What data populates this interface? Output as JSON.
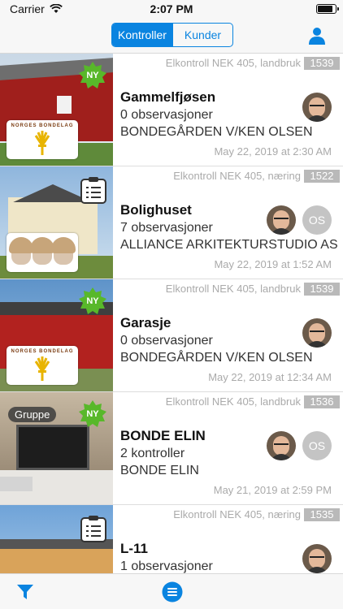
{
  "status": {
    "carrier": "Carrier",
    "time": "2:07 PM",
    "battery_level": 0.9
  },
  "nav": {
    "segments": [
      "Kontroller",
      "Kunder"
    ],
    "active_segment": "Kontroller",
    "profile_icon": "person-icon"
  },
  "accent": "#0a84e0",
  "rows": [
    {
      "type": "Elkontroll NEK 405, landbruk",
      "number": "1539",
      "title": "Gammelfjøsen",
      "line1": "0 observasjoner",
      "line2": "BONDEGÅRDEN V/KEN OLSEN",
      "date": "May 22, 2019 at 2:30 AM",
      "badge": "NY",
      "logo_text": "NORGES BONDELAG"
    },
    {
      "type": "Elkontroll NEK 405, næring",
      "number": "1522",
      "title": "Bolighuset",
      "line1": "7 observasjoner",
      "line2": "ALLIANCE ARKITEKTURSTUDIO AS",
      "date": "May 22, 2019 at 1:52 AM",
      "initials": "OS"
    },
    {
      "type": "Elkontroll NEK 405, landbruk",
      "number": "1539",
      "title": "Garasje",
      "line1": "0 observasjoner",
      "line2": "BONDEGÅRDEN V/KEN OLSEN",
      "date": "May 22, 2019 at 12:34 AM",
      "badge": "NY",
      "logo_text": "NORGES BONDELAG"
    },
    {
      "type": "Elkontroll NEK 405, landbruk",
      "number": "1536",
      "title": "BONDE ELIN",
      "line1": "2 kontroller",
      "line2": "BONDE ELIN",
      "date": "May 21, 2019 at 2:59 PM",
      "badge": "NY",
      "group": "Gruppe",
      "initials": "OS"
    },
    {
      "type": "Elkontroll NEK 405, næring",
      "number": "1535",
      "title": "L-11",
      "line1": "1 observasjoner",
      "line2": "",
      "date": ""
    }
  ],
  "tabbar": {
    "left_icon": "filter-icon",
    "center_icon": "list-menu-icon"
  }
}
